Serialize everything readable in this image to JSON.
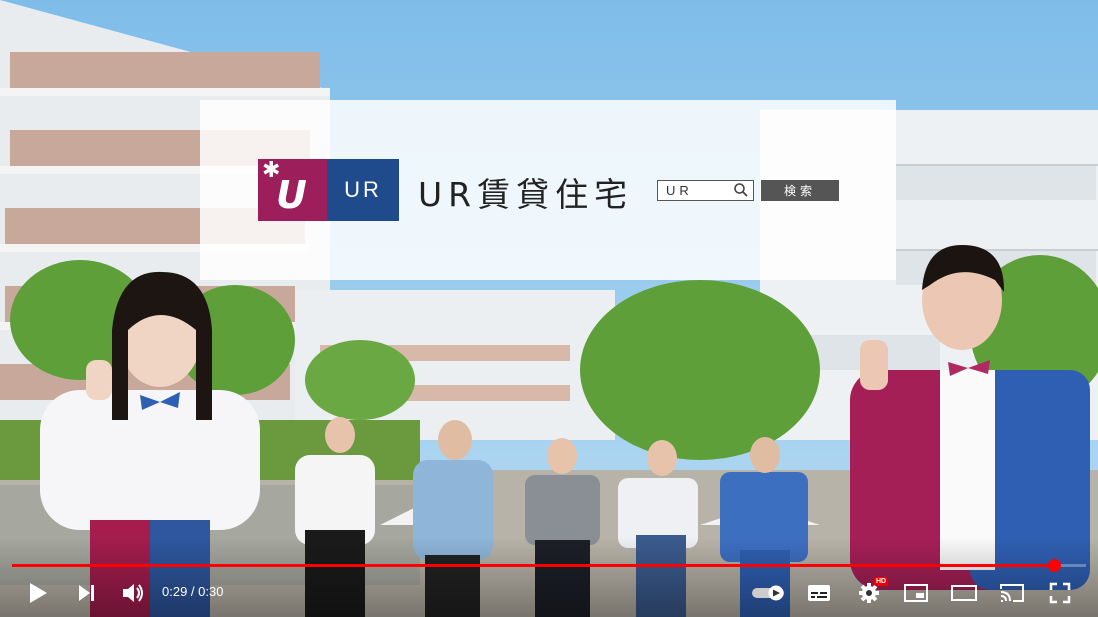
{
  "banner": {
    "logo_text": "UR",
    "title": "UR賃貸住宅",
    "search_value": "UR",
    "search_button": "検索"
  },
  "player": {
    "current_time": "0:29",
    "separator": " / ",
    "duration": "0:30",
    "progress_fraction": 0.97,
    "hd_badge": "HD"
  },
  "colors": {
    "accent": "#ff0000",
    "logo_magenta": "#9c1f5c",
    "logo_blue": "#1f4a8c",
    "sky": "#8ec6ee"
  },
  "icons": [
    "play-icon",
    "next-icon",
    "volume-icon",
    "autoplay-toggle-icon",
    "subtitles-icon",
    "settings-icon",
    "miniplayer-icon",
    "theater-icon",
    "cast-icon",
    "fullscreen-icon"
  ]
}
